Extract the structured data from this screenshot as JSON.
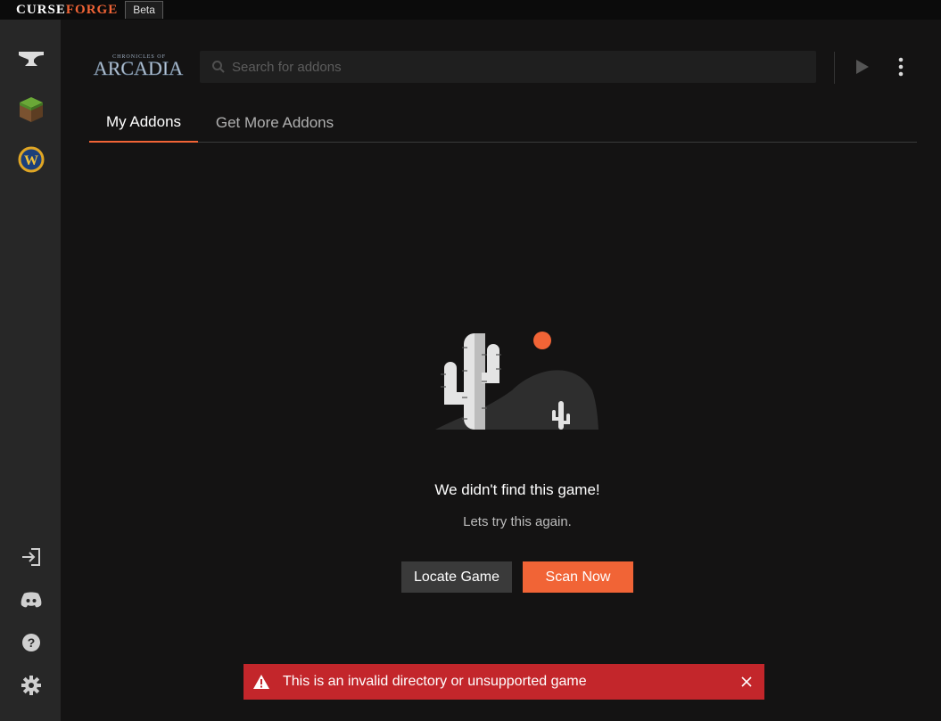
{
  "titlebar": {
    "brand_curse": "CURSE",
    "brand_forge": "FORGE",
    "beta": "Beta"
  },
  "sidebar": {
    "top_items": [
      {
        "name": "anvil-icon"
      },
      {
        "name": "minecraft-icon"
      },
      {
        "name": "wow-icon"
      }
    ],
    "bottom_items": [
      {
        "name": "login-icon"
      },
      {
        "name": "discord-icon"
      },
      {
        "name": "help-icon"
      },
      {
        "name": "settings-icon"
      }
    ]
  },
  "header": {
    "game_logo_small": "CHRONICLES OF",
    "game_logo_big": "ARCADIA",
    "search_placeholder": "Search for addons"
  },
  "tabs": [
    {
      "label": "My Addons",
      "active": true
    },
    {
      "label": "Get More Addons",
      "active": false
    }
  ],
  "empty_state": {
    "title": "We didn't find this game!",
    "subtitle": "Lets try this again.",
    "locate_label": "Locate Game",
    "scan_label": "Scan Now"
  },
  "toast": {
    "message": "This is an invalid directory or unsupported game"
  },
  "colors": {
    "accent": "#f16436",
    "error": "#c3262b",
    "sidebar": "#272727",
    "background": "#141313"
  }
}
